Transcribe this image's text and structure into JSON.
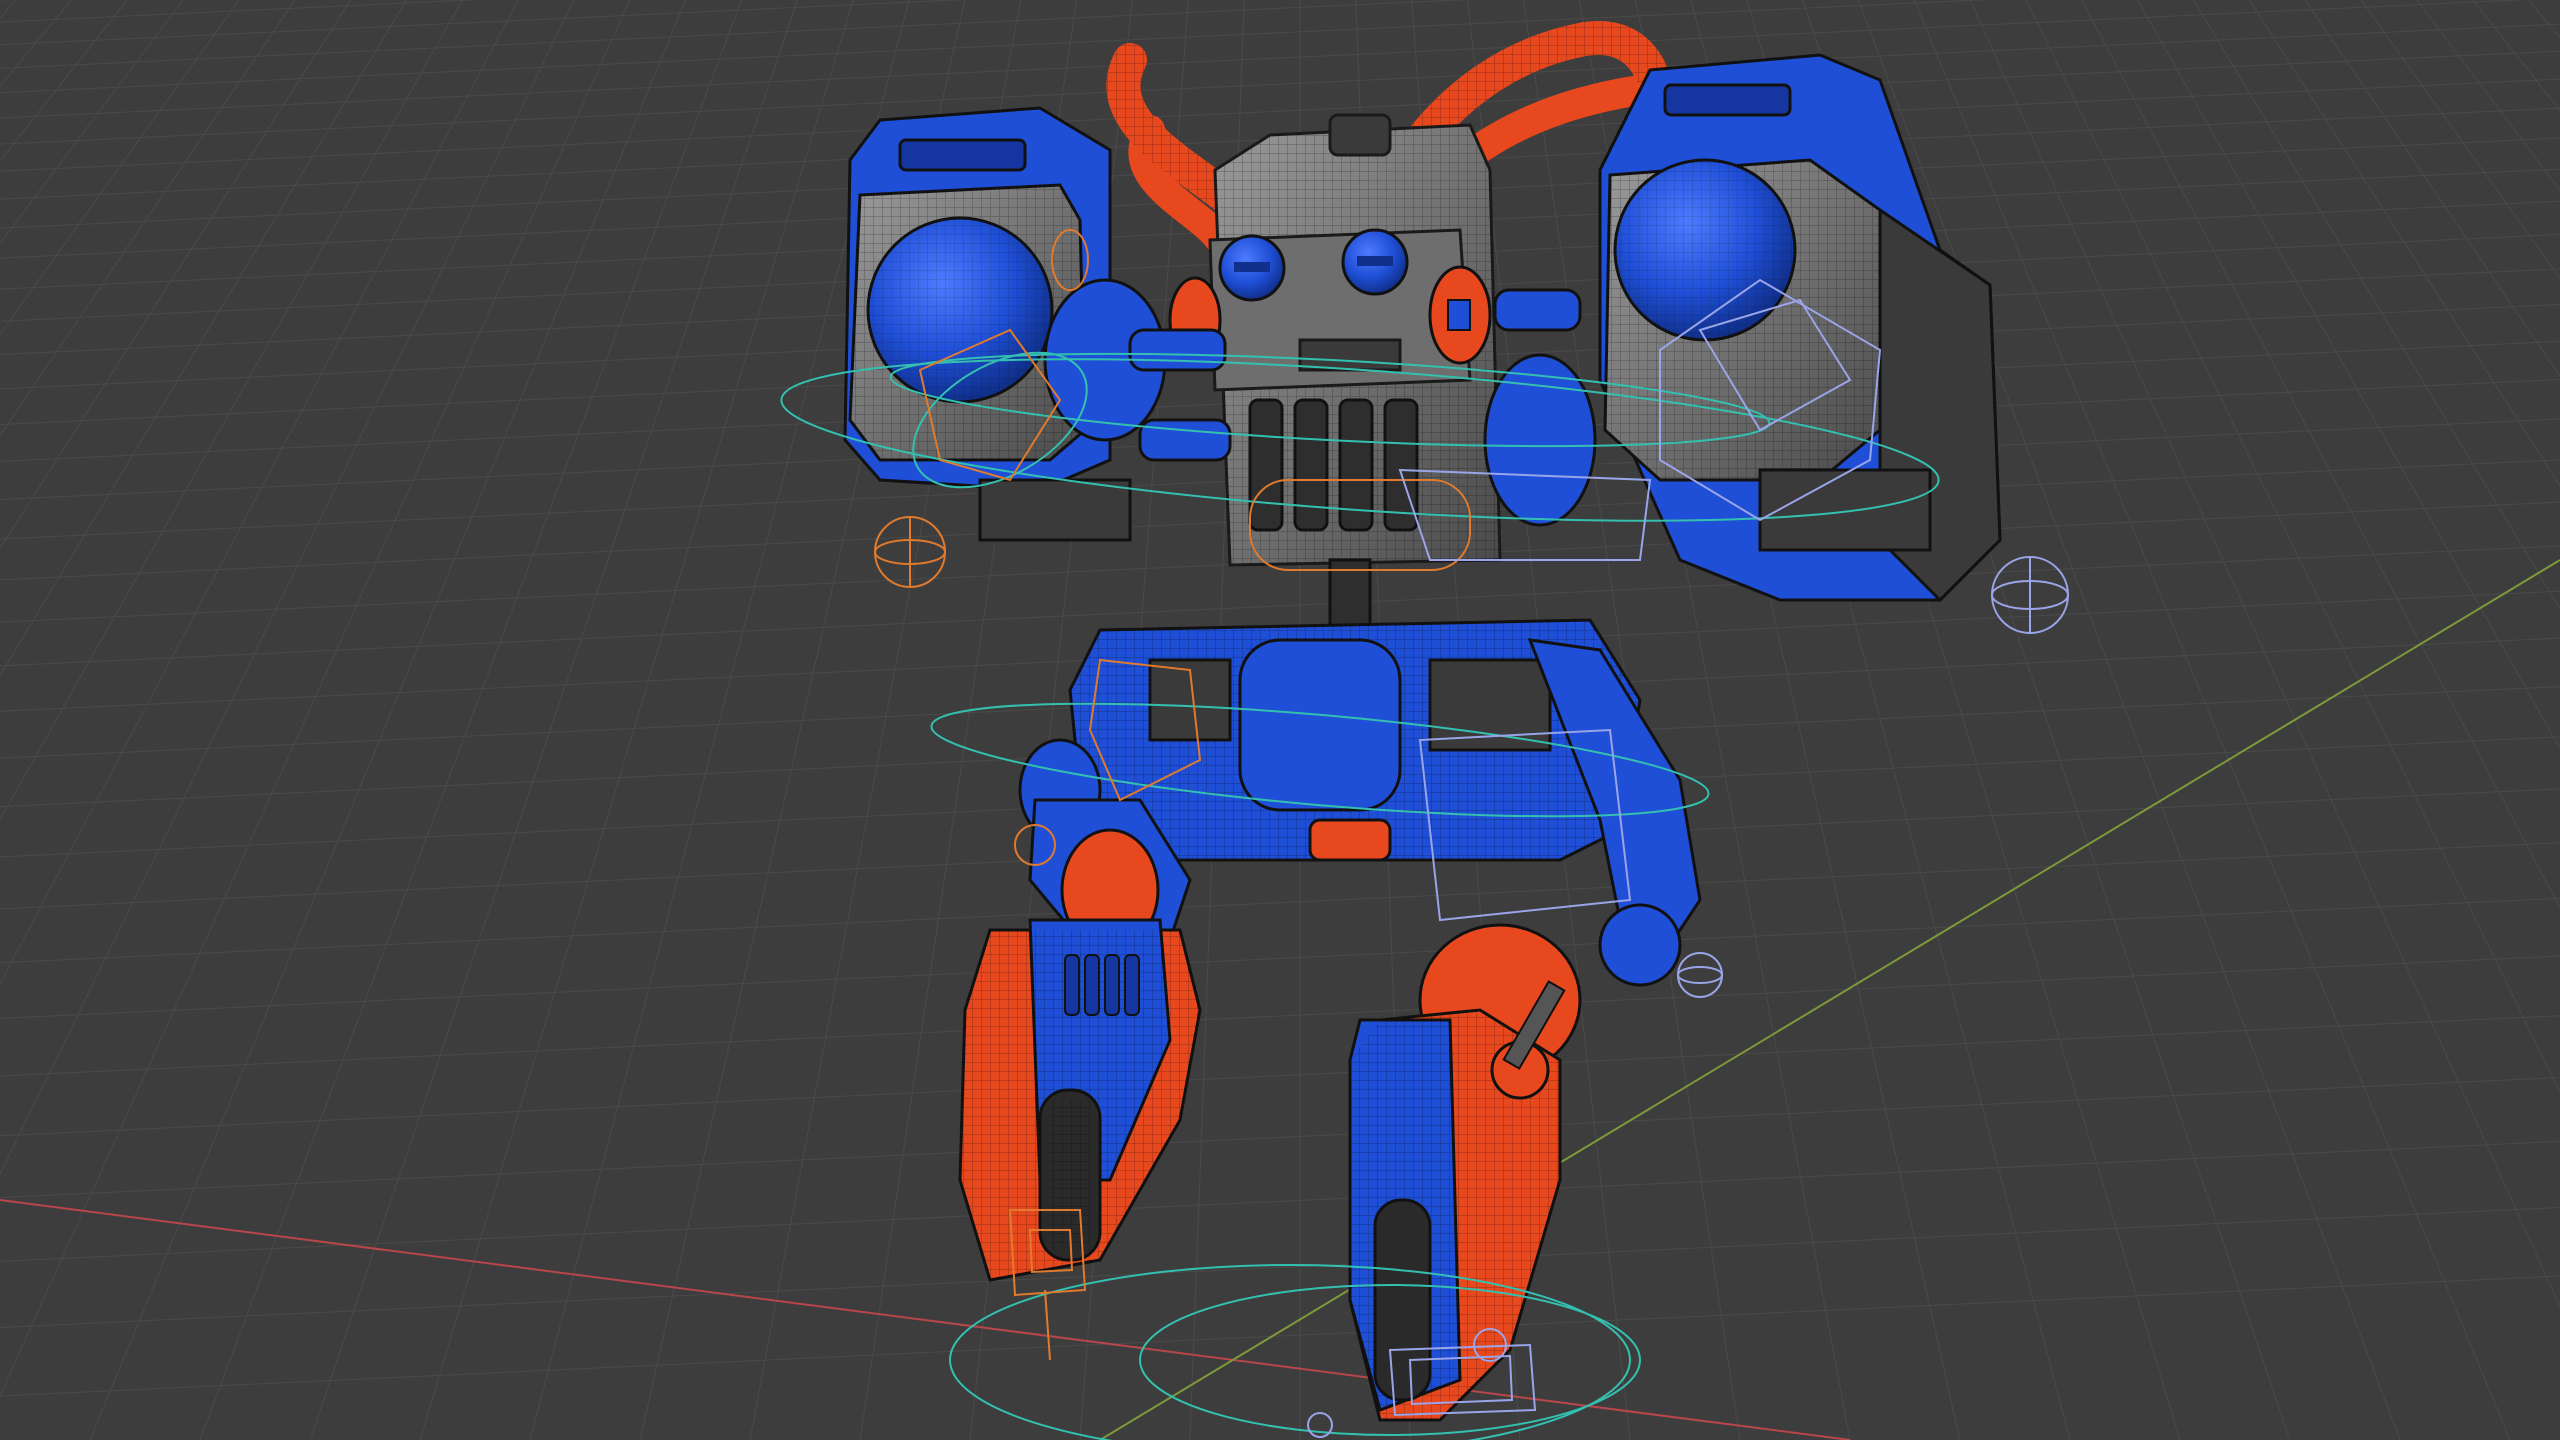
{
  "viewport": {
    "background_color": "#3d3d3d",
    "grid_line_color": "#4a4a4a",
    "x_axis_color": "#b8464b",
    "y_axis_color": "#7d9a3b"
  },
  "model": {
    "primary_blue": "#1f4fd6",
    "dark_blue": "#1536a0",
    "accent_orange": "#e8481e",
    "dark_orange": "#a93414",
    "metal_gray": "#6e6e6e",
    "dark_gray": "#3a3a3a",
    "wire_color": "#1a1a1a"
  },
  "rig": {
    "control_teal": "#34c0b0",
    "control_orange": "#e07a2e",
    "control_lavender": "#9aa4e8"
  }
}
